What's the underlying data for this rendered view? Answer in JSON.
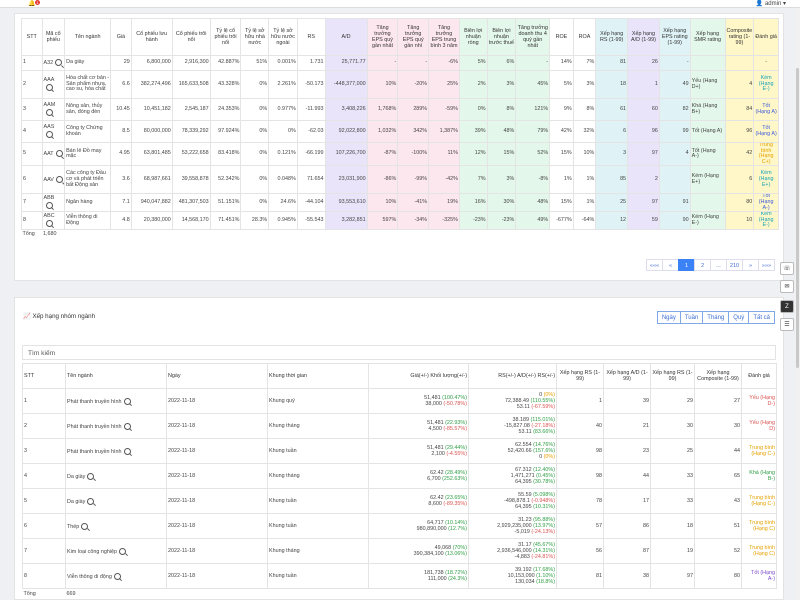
{
  "topbar": {
    "user": "admin",
    "notifications": "1"
  },
  "table1": {
    "headers": [
      "STT",
      "Mã cổ phiếu",
      "Tên ngành",
      "Giá",
      "Cổ phiếu lưu hành",
      "Cổ phiếu trôi nổi",
      "Tỷ lệ cổ phiếu trôi nổi",
      "Tỷ lệ sở hữu nhà nước",
      "Tỷ lệ sở hữu nước ngoài",
      "RS",
      "A/D",
      "Tăng trưởng EPS quý gần nhất",
      "Tăng trưởng EPS quý gần nhì",
      "Tăng trưởng EPS trung bình 3 năm",
      "Biên lợi nhuận ròng",
      "Biên lợi nhuận trước thuế",
      "Tăng trưởng doanh thu 4 quý gần nhất",
      "ROE",
      "ROA",
      "Xếp hạng RS (1-99)",
      "Xếp hạng A/D (1-99)",
      "Xếp hạng EPS rating (1-99)",
      "Xếp hạng SMR rating",
      "Composite rating (1-99)",
      "Đánh giá"
    ],
    "rows": [
      {
        "stt": "1",
        "code": "A32",
        "industry": "Da giày",
        "price": "29",
        "shares_out": "6,800,000",
        "float": "2,916,300",
        "float_ratio": "42.887%",
        "state": "51%",
        "foreign": "0.001%",
        "rs": "1.731",
        "ad": "25,771.77",
        "eps1": "-",
        "eps2": "-",
        "eps3": "-6%",
        "npm": "5%",
        "ptm": "6%",
        "rev": "-",
        "roe": "14%",
        "roa": "7%",
        "r_rs": "81",
        "r_ad": "26",
        "r_eps": "-",
        "smr": "",
        "comp": "",
        "rating": "-",
        "cls": ""
      },
      {
        "stt": "2",
        "code": "AAA",
        "industry": "Hóa chất cơ bản - Sản phẩm nhựa, cao su, hóa chất",
        "price": "6.6",
        "shares_out": "382,274,496",
        "float": "165,633,508",
        "float_ratio": "43.328%",
        "state": "0%",
        "foreign": "2.261%",
        "rs": "-50.173",
        "ad": "-448,377,000",
        "eps1": "10%",
        "eps2": "-20%",
        "eps3": "25%",
        "npm": "2%",
        "ptm": "3%",
        "rev": "45%",
        "roe": "5%",
        "roa": "3%",
        "r_rs": "18",
        "r_ad": "1",
        "r_eps": "49",
        "smr": "Yếu (Hạng D+)",
        "comp": "4",
        "rating": "Kém (Hạng E-)",
        "cls": "r-cyan"
      },
      {
        "stt": "3",
        "code": "AAM",
        "industry": "Nông sản, thủy sản, đóng đèn",
        "price": "10.45",
        "shares_out": "10,451,182",
        "float": "2,545,187",
        "float_ratio": "24.353%",
        "state": "0%",
        "foreign": "0.977%",
        "rs": "-11.993",
        "ad": "3,408,226",
        "eps1": "1,768%",
        "eps2": "289%",
        "eps3": "-59%",
        "npm": "0%",
        "ptm": "8%",
        "rev": "121%",
        "roe": "9%",
        "roa": "8%",
        "r_rs": "61",
        "r_ad": "60",
        "r_eps": "82",
        "smr": "Khá (Hạng B+)",
        "comp": "84",
        "rating": "Tốt (Hạng A)",
        "cls": "r-good"
      },
      {
        "stt": "4",
        "code": "AAS",
        "industry": "Công ty Chứng khoán",
        "price": "8.5",
        "shares_out": "80,000,000",
        "float": "78,339,292",
        "float_ratio": "97.924%",
        "state": "0%",
        "foreign": "0%",
        "rs": "-62.03",
        "ad": "92,022,800",
        "eps1": "1,032%",
        "eps2": "342%",
        "eps3": "1,387%",
        "npm": "39%",
        "ptm": "48%",
        "rev": "79%",
        "roe": "42%",
        "roa": "32%",
        "r_rs": "6",
        "r_ad": "96",
        "r_eps": "99",
        "smr": "Tốt (Hạng A)",
        "comp": "96",
        "rating": "Tốt (Hạng A)",
        "cls": "r-good"
      },
      {
        "stt": "5",
        "code": "AAT",
        "industry": "Bán lẻ Đồ may mặc",
        "price": "4.95",
        "shares_out": "63,801,485",
        "float": "53,222,658",
        "float_ratio": "83.418%",
        "state": "0%",
        "foreign": "0.121%",
        "rs": "-66.199",
        "ad": "107,226,700",
        "eps1": "-87%",
        "eps2": "-100%",
        "eps3": "11%",
        "npm": "12%",
        "ptm": "15%",
        "rev": "52%",
        "roe": "15%",
        "roa": "10%",
        "r_rs": "3",
        "r_ad": "97",
        "r_eps": "4",
        "smr": "Tốt (Hạng A-)",
        "comp": "42",
        "rating": "Trung bình (Hạng C+)",
        "cls": "r-mid"
      },
      {
        "stt": "6",
        "code": "AAV",
        "industry": "Các công ty Đầu cơ và phát triển bất Động sản",
        "price": "3.6",
        "shares_out": "68,987,661",
        "float": "39,558,878",
        "float_ratio": "52.342%",
        "state": "0%",
        "foreign": "0.048%",
        "rs": "71.654",
        "ad": "23,031,900",
        "eps1": "-86%",
        "eps2": "-99%",
        "eps3": "-42%",
        "npm": "7%",
        "ptm": "3%",
        "rev": "-8%",
        "roe": "1%",
        "roa": "1%",
        "r_rs": "85",
        "r_ad": "2",
        "r_eps": "",
        "smr": "Kém (Hạng E+)",
        "comp": "6",
        "rating": "Kém (Hạng E+)",
        "cls": "r-cyan"
      },
      {
        "stt": "7",
        "code": "ABB",
        "industry": "Ngân hàng",
        "price": "7.1",
        "shares_out": "940,047,882",
        "float": "481,307,503",
        "float_ratio": "51.151%",
        "state": "0%",
        "foreign": "24.6%",
        "rs": "-44.104",
        "ad": "93,553,610",
        "eps1": "10%",
        "eps2": "-41%",
        "eps3": "19%",
        "npm": "16%",
        "ptm": "30%",
        "rev": "48%",
        "roe": "15%",
        "roa": "1%",
        "r_rs": "25",
        "r_ad": "97",
        "r_eps": "91",
        "smr": "",
        "comp": "80",
        "rating": "Tốt (Hạng A-)",
        "cls": "r-good"
      },
      {
        "stt": "8",
        "code": "ABC",
        "industry": "Viễn thông di Động",
        "price": "4.8",
        "shares_out": "20,380,000",
        "float": "14,568,170",
        "float_ratio": "71.451%",
        "state": "28.3%",
        "foreign": "0.945%",
        "rs": "-55.543",
        "ad": "3,282,851",
        "eps1": "597%",
        "eps2": "-34%",
        "eps3": "-325%",
        "npm": "-23%",
        "ptm": "-23%",
        "rev": "49%",
        "roe": "-677%",
        "roa": "-64%",
        "r_rs": "12",
        "r_ad": "59",
        "r_eps": "90",
        "smr": "Kém (Hạng E-)",
        "comp": "10",
        "rating": "Kém (Hạng E-)",
        "cls": "r-cyan"
      }
    ],
    "total_label": "Tổng",
    "total_value": "1,680",
    "pager": [
      "«««",
      "«",
      "1",
      "2",
      "...",
      "210",
      "»",
      "»»»"
    ]
  },
  "section2": {
    "title": "Xếp hạng nhóm ngành",
    "periods": [
      "Ngày",
      "Tuần",
      "Tháng",
      "Quý",
      "Tất cả"
    ],
    "search_placeholder": "Tìm kiếm",
    "headers": [
      "STT",
      "Tên ngành",
      "Ngày",
      "Khung thời gian",
      "Giá(+/-) Khối lượng(+/-)",
      "RS(+/-) A/D(+/-) RS(+/-)",
      "Xếp hạng RS (1-99)",
      "Xếp hạng A/D (1-99)",
      "Xếp hạng RS (1-99)",
      "Xếp hạng Composite (1-99)",
      "Đánh giá"
    ],
    "rows": [
      {
        "stt": "1",
        "name": "Phát thanh truyền hình",
        "date": "2022-11-18",
        "frame": "Khung quý",
        "p1": "51,481",
        "p1c": "(100.47%)",
        "p1k": "up",
        "p2": "38,000",
        "p2c": "(-50.78%)",
        "p2k": "dn",
        "r1": "0",
        "r1c": "(0%)",
        "r1k": "zero",
        "r2": "72,388.49",
        "r2c": "(110.55%)",
        "r2k": "up",
        "r3": "53.11",
        "r3c": "(-67.59%)",
        "r3k": "dn",
        "x1": "1",
        "x2": "39",
        "x3": "29",
        "x4": "27",
        "rating": "Yếu (Hạng D-)",
        "cls": "r-bad"
      },
      {
        "stt": "2",
        "name": "Phát thanh truyền hình",
        "date": "2022-11-18",
        "frame": "Khung tháng",
        "p1": "51,481",
        "p1c": "(22.93%)",
        "p1k": "up",
        "p2": "4,500",
        "p2c": "(-85.57%)",
        "p2k": "dn",
        "r1": "38.189",
        "r1c": "(115.01%)",
        "r1k": "up",
        "r2": "-15,827.08",
        "r2c": "(-27.18%)",
        "r2k": "dn",
        "r3": "53.11",
        "r3c": "(83.66%)",
        "r3k": "up",
        "x1": "40",
        "x2": "21",
        "x3": "30",
        "x4": "30",
        "rating": "Yếu (Hạng D)",
        "cls": "r-bad"
      },
      {
        "stt": "3",
        "name": "Phát thanh truyền hình",
        "date": "2022-11-18",
        "frame": "Khung tuần",
        "p1": "51,481",
        "p1c": "(29.44%)",
        "p1k": "up",
        "p2": "2,100",
        "p2c": "(-4.55%)",
        "p2k": "dn",
        "r1": "62.554",
        "r1c": "(14.76%)",
        "r1k": "up",
        "r2": "52,420.66",
        "r2c": "(157.6%)",
        "r2k": "up",
        "r3": "0",
        "r3c": "(0%)",
        "r3k": "zero",
        "x1": "98",
        "x2": "23",
        "x3": "25",
        "x4": "44",
        "rating": "Trung bình (Hạng C-)",
        "cls": "r-mid"
      },
      {
        "stt": "4",
        "name": "Da giày",
        "date": "2022-11-18",
        "frame": "Khung tháng",
        "p1": "62.42",
        "p1c": "(28.49%)",
        "p1k": "up",
        "p2": "6,700",
        "p2c": "(252.63%)",
        "p2k": "up",
        "r1": "67.312",
        "r1c": "(12.40%)",
        "r1k": "up",
        "r2": "1,471,271",
        "r2c": "(0.45%)",
        "r2k": "up",
        "r3": "64,395",
        "r3c": "(30.78%)",
        "r3k": "up",
        "x1": "98",
        "x2": "44",
        "x3": "33",
        "x4": "65",
        "rating": "Khá (Hạng B-)",
        "cls": "r-ok"
      },
      {
        "stt": "5",
        "name": "Da giày",
        "date": "2022-11-18",
        "frame": "Khung tuần",
        "p1": "62.42",
        "p1c": "(23.65%)",
        "p1k": "up",
        "p2": "8,600",
        "p2c": "(-89.35%)",
        "p2k": "dn",
        "r1": "55.59",
        "r1c": "(5.098%)",
        "r1k": "up",
        "r2": "-498,878.1",
        "r2c": "(-0.948%)",
        "r2k": "dn",
        "r3": "64,395",
        "r3c": "(10.31%)",
        "r3k": "up",
        "x1": "78",
        "x2": "17",
        "x3": "33",
        "x4": "43",
        "rating": "Trung bình (Hạng C-)",
        "cls": "r-mid"
      },
      {
        "stt": "6",
        "name": "Thép",
        "date": "2022-11-18",
        "frame": "Khung tuần",
        "p1": "64,717",
        "p1c": "(10.14%)",
        "p1k": "up",
        "p2": "980,890,000",
        "p2c": "(12.7%)",
        "p2k": "up",
        "r1": "31.23",
        "r1c": "(95.88%)",
        "r1k": "up",
        "r2": "2,929,235,000",
        "r2c": "(13.97%)",
        "r2k": "up",
        "r3": "-5,019",
        "r3c": "(-24.13%)",
        "r3k": "dn",
        "x1": "57",
        "x2": "86",
        "x3": "18",
        "x4": "51",
        "rating": "Trung bình (Hạng C)",
        "cls": "r-mid"
      },
      {
        "stt": "7",
        "name": "Kim loại công nghiệp",
        "date": "2022-11-18",
        "frame": "Khung tháng",
        "p1": "49,068",
        "p1c": "(70%)",
        "p1k": "up",
        "p2": "390,384,100",
        "p2c": "(13.06%)",
        "p2k": "up",
        "r1": "31.17",
        "r1c": "(45.67%)",
        "r1k": "up",
        "r2": "2,936,546,000",
        "r2c": "(14.31%)",
        "r2k": "up",
        "r3": "-4,883",
        "r3c": "(-24.81%)",
        "r3k": "dn",
        "x1": "56",
        "x2": "87",
        "x3": "19",
        "x4": "52",
        "rating": "Trung bình (Hạng C)",
        "cls": "r-mid"
      },
      {
        "stt": "8",
        "name": "Viễn thông di động",
        "date": "2022-11-18",
        "frame": "Khung tuần",
        "p1": "181,738",
        "p1c": "(18.72%)",
        "p1k": "up",
        "p2": "111,000",
        "p2c": "(24.3%)",
        "p2k": "up",
        "r1": "39.192",
        "r1c": "(17.68%)",
        "r1k": "up",
        "r2": "10,153,090",
        "r2c": "(1.10%)",
        "r2k": "up",
        "r3": "130,034",
        "r3c": "(18.8%)",
        "r3k": "up",
        "x1": "81",
        "x2": "38",
        "x3": "97",
        "x4": "80",
        "rating": "Tốt (Hạng A-)",
        "cls": "r-pur"
      }
    ],
    "total_label": "Tổng",
    "total_value": "669"
  }
}
